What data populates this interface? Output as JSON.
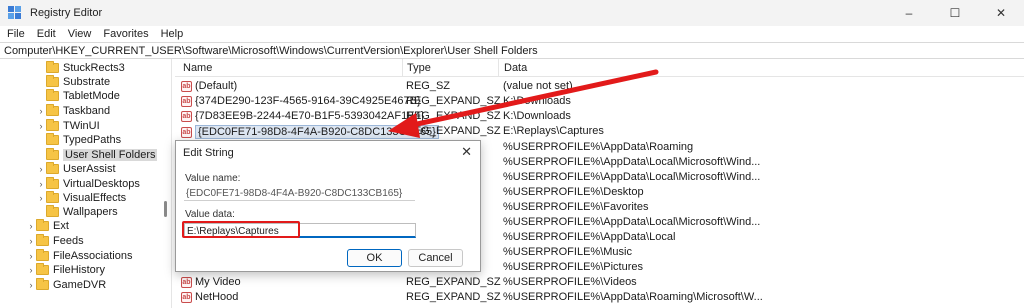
{
  "window": {
    "title": "Registry Editor",
    "controls": [
      "–",
      "☐",
      "✕"
    ]
  },
  "menu": [
    "File",
    "Edit",
    "View",
    "Favorites",
    "Help"
  ],
  "address": "Computer\\HKEY_CURRENT_USER\\Software\\Microsoft\\Windows\\CurrentVersion\\Explorer\\User Shell Folders",
  "tree": [
    {
      "label": "StuckRects3",
      "chev": ""
    },
    {
      "label": "Substrate",
      "chev": ""
    },
    {
      "label": "TabletMode",
      "chev": ""
    },
    {
      "label": "Taskband",
      "chev": "›"
    },
    {
      "label": "TWinUI",
      "chev": "›"
    },
    {
      "label": "TypedPaths",
      "chev": ""
    },
    {
      "label": "User Shell Folders",
      "chev": ""
    },
    {
      "label": "UserAssist",
      "chev": "›"
    },
    {
      "label": "VirtualDesktops",
      "chev": "›"
    },
    {
      "label": "VisualEffects",
      "chev": "›"
    },
    {
      "label": "Wallpapers",
      "chev": ""
    },
    {
      "label": "Ext",
      "chev": "›"
    },
    {
      "label": "Feeds",
      "chev": "›"
    },
    {
      "label": "FileAssociations",
      "chev": "›"
    },
    {
      "label": "FileHistory",
      "chev": "›"
    },
    {
      "label": "GameDVR",
      "chev": "›"
    }
  ],
  "columns": {
    "name": "Name",
    "type": "Type",
    "data": "Data"
  },
  "rows": [
    {
      "name": "(Default)",
      "type": "REG_SZ",
      "data": "(value not set)"
    },
    {
      "name": "{374DE290-123F-4565-9164-39C4925E467B}",
      "type": "REG_EXPAND_SZ",
      "data": "K:\\Downloads"
    },
    {
      "name": "{7D83EE9B-2244-4E70-B1F5-5393042AF1E4}",
      "type": "REG_EXPAND_SZ",
      "data": "K:\\Downloads"
    },
    {
      "name": "{EDC0FE71-98D8-4F4A-B920-C8DC133CB165}",
      "type": "REG_EXPAND_SZ",
      "data": "E:\\Replays\\Captures"
    },
    {
      "name": "",
      "type": "",
      "data": "%USERPROFILE%\\AppData\\Roaming"
    },
    {
      "name": "",
      "type": "",
      "data": "%USERPROFILE%\\AppData\\Local\\Microsoft\\Wind..."
    },
    {
      "name": "",
      "type": "",
      "data": "%USERPROFILE%\\AppData\\Local\\Microsoft\\Wind..."
    },
    {
      "name": "",
      "type": "",
      "data": "%USERPROFILE%\\Desktop"
    },
    {
      "name": "",
      "type": "",
      "data": "%USERPROFILE%\\Favorites"
    },
    {
      "name": "",
      "type": "",
      "data": "%USERPROFILE%\\AppData\\Local\\Microsoft\\Wind..."
    },
    {
      "name": "",
      "type": "",
      "data": "%USERPROFILE%\\AppData\\Local"
    },
    {
      "name": "",
      "type": "",
      "data": "%USERPROFILE%\\Music"
    },
    {
      "name": "",
      "type": "",
      "data": "%USERPROFILE%\\Pictures"
    },
    {
      "name": "My Video",
      "type": "REG_EXPAND_SZ",
      "data": "%USERPROFILE%\\Videos"
    },
    {
      "name": "NetHood",
      "type": "REG_EXPAND_SZ",
      "data": "%USERPROFILE%\\AppData\\Roaming\\Microsoft\\W..."
    }
  ],
  "dialog": {
    "title": "Edit String",
    "close": "✕",
    "value_name_label": "Value name:",
    "value_name": "{EDC0FE71-98D8-4F4A-B920-C8DC133CB165}",
    "value_data_label": "Value data:",
    "value_data": "E:\\Replays\\Captures",
    "ok": "OK",
    "cancel": "Cancel"
  },
  "accent_colors": {
    "annotation": "#e21a1a",
    "focus": "#0067c0"
  }
}
